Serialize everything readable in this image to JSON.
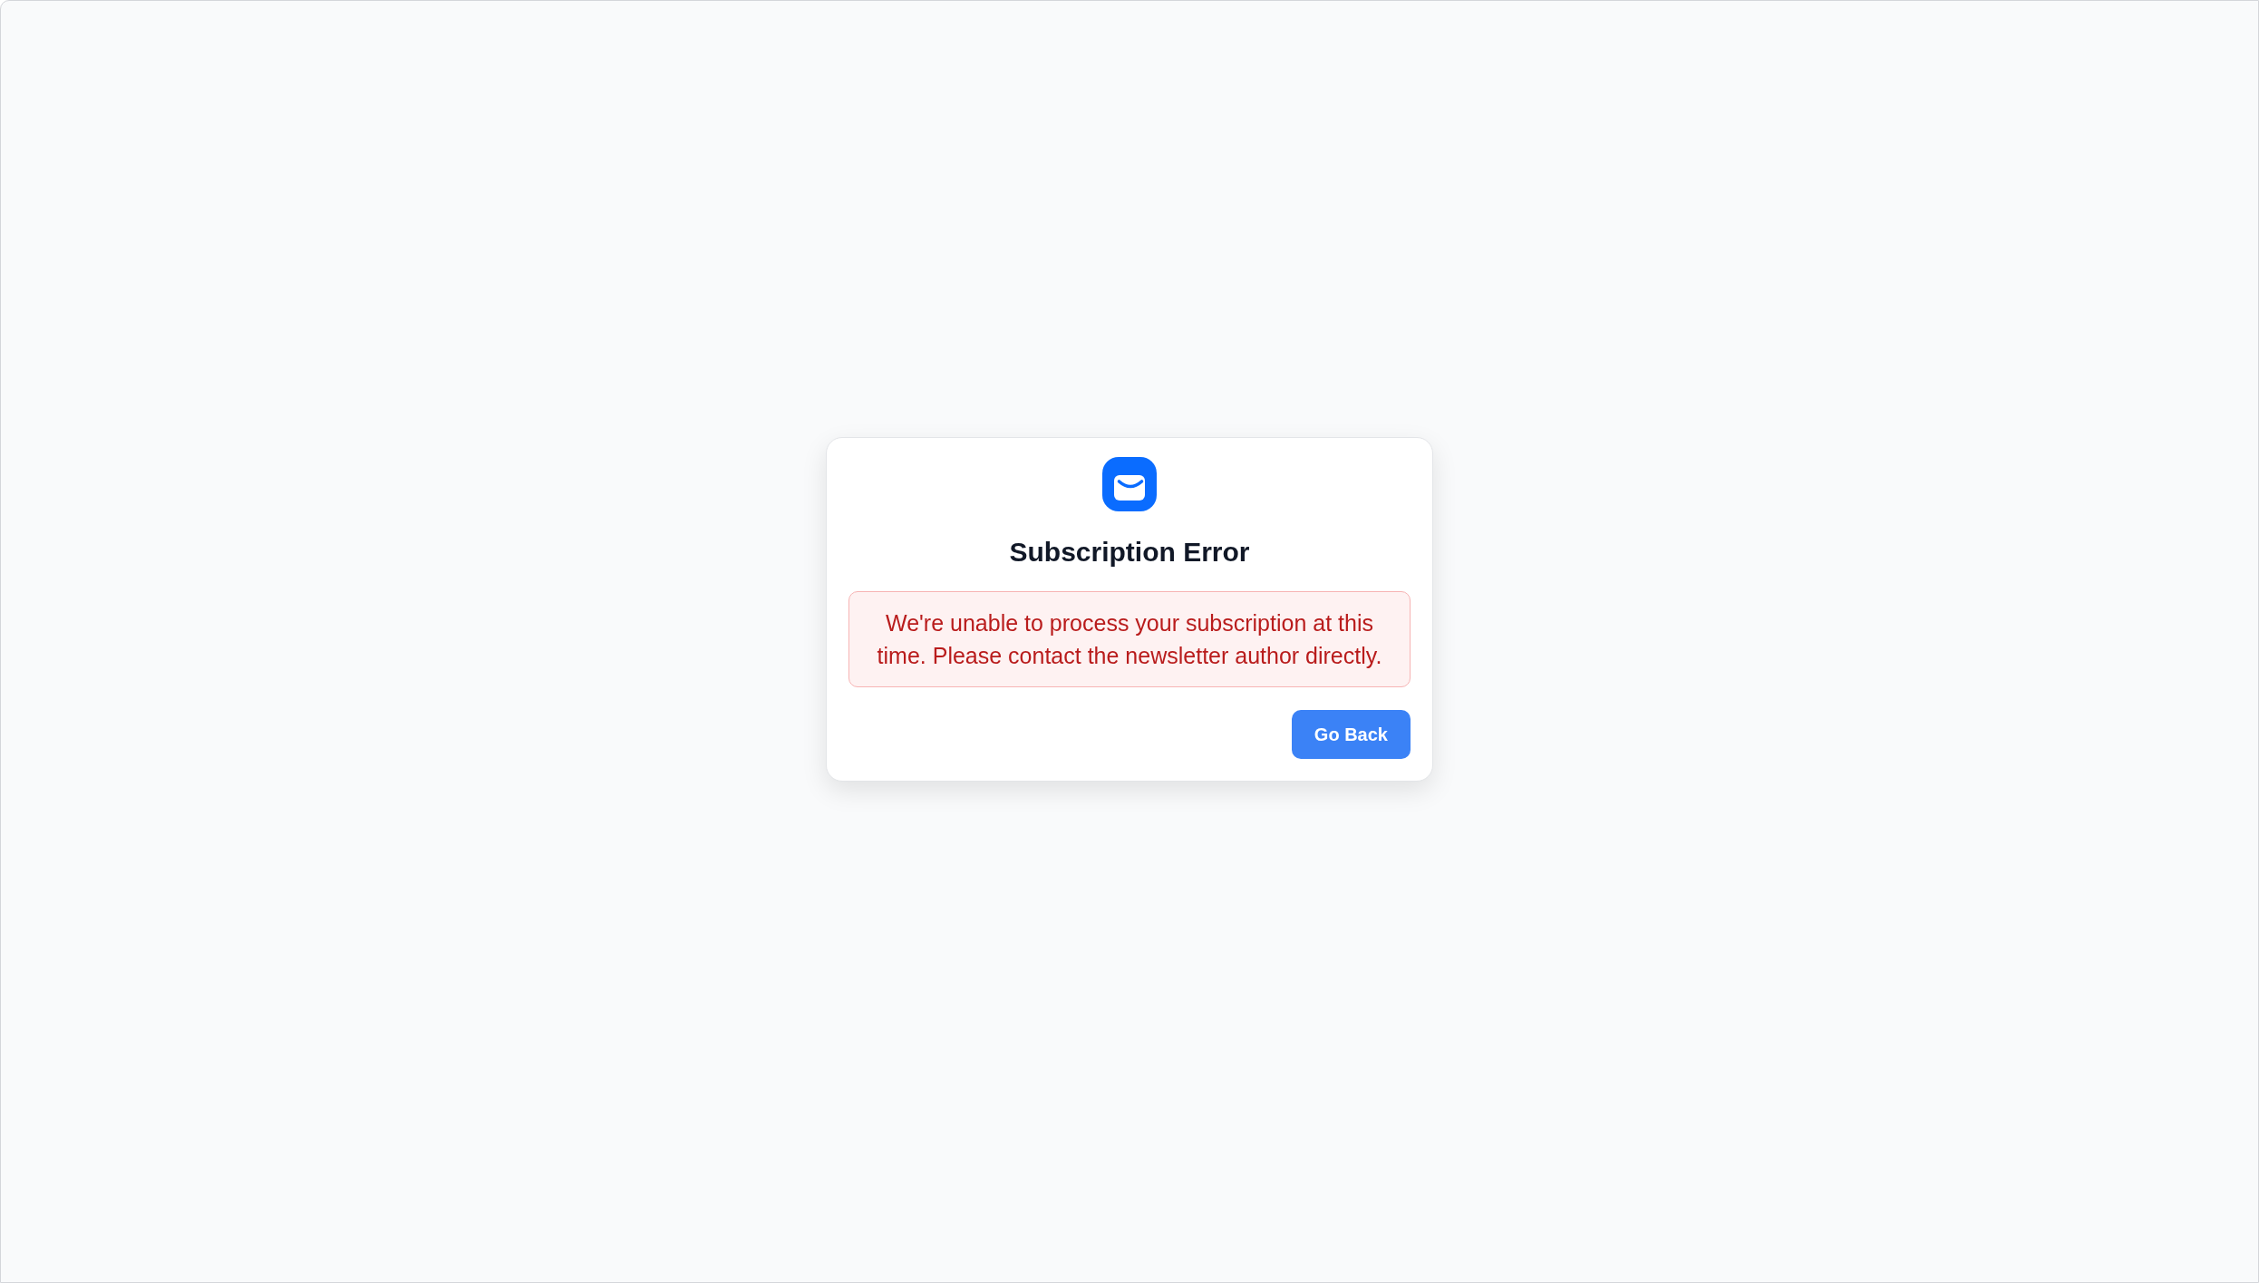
{
  "dialog": {
    "title": "Subscription Error",
    "error_message": "We're unable to process your subscription at this time. Please contact the newsletter author directly.",
    "button": "Go Back"
  }
}
